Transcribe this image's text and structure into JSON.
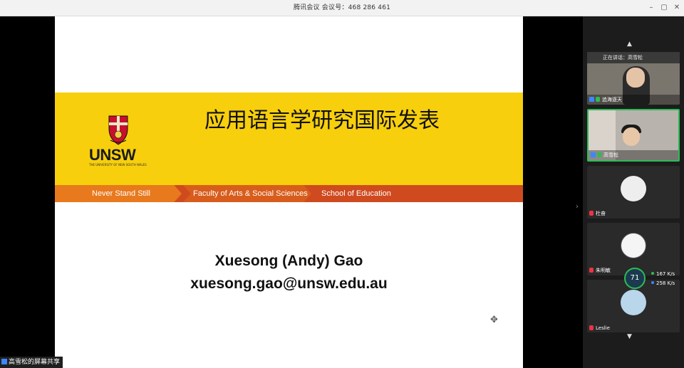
{
  "window": {
    "title": "腾讯会议 会议号：468 286 461",
    "minimize": "–",
    "maximize": "▢",
    "close": "✕"
  },
  "slide": {
    "title": "应用语言学研究国际发表",
    "logo_text": "UNSW",
    "logo_subtext": "THE UNIVERSITY OF NEW SOUTH WALES",
    "tabs": [
      "Never Stand Still",
      "Faculty of Arts & Social Sciences",
      "School of Education"
    ],
    "presenter_name": "Xuesong (Andy) Gao",
    "presenter_email": "xuesong.gao@unsw.edu.au",
    "colors": {
      "yellow": "#f7cf0c",
      "orange": "#e8791d",
      "red_orange": "#cf4b1f"
    }
  },
  "share_label": "高雪松的屏幕共享",
  "panel": {
    "speaking_now": "正在讲话：高雪松",
    "participants": [
      {
        "name": "追海逐天",
        "mic": "on"
      },
      {
        "name": "高雪松",
        "mic": "on"
      },
      {
        "name": "杜奋",
        "mic": "off"
      },
      {
        "name": "朱明敏",
        "mic": "off"
      },
      {
        "name": "Leslie",
        "mic": "off"
      }
    ]
  },
  "network": {
    "score": "71",
    "upload": "167",
    "download": "258",
    "unit": "K/s"
  }
}
